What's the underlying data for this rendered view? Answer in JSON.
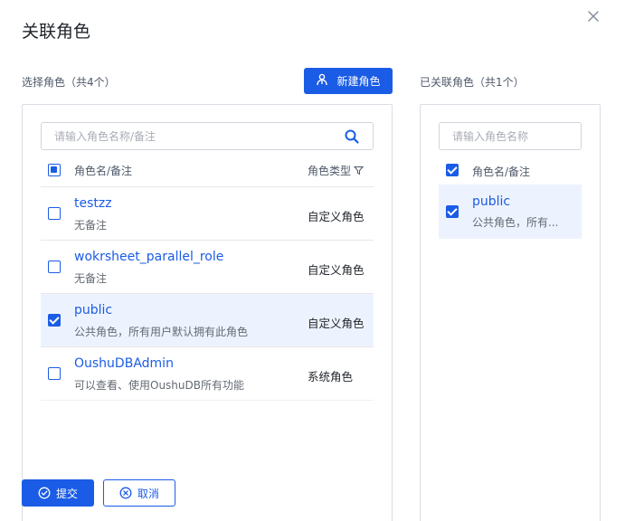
{
  "dialog": {
    "title": "关联角色",
    "close_icon": "close-icon"
  },
  "left": {
    "label": "选择角色（共4个）",
    "new_button_label": "新建角色",
    "new_button_icon": "new-role-icon",
    "search_placeholder": "请输入角色名称/备注",
    "search_value": "",
    "header_name": "角色名/备注",
    "header_type": "角色类型",
    "rows": [
      {
        "name": "testzz",
        "desc": "无备注",
        "type": "自定义角色",
        "checked": false
      },
      {
        "name": "wokrsheet_parallel_role",
        "desc": "无备注",
        "type": "自定义角色",
        "checked": false
      },
      {
        "name": "public",
        "desc": "公共角色，所有用户默认拥有此角色",
        "type": "自定义角色",
        "checked": true
      },
      {
        "name": "OushuDBAdmin",
        "desc": "可以查看、使用OushuDB所有功能",
        "type": "系统角色",
        "checked": false
      }
    ]
  },
  "right": {
    "label": "已关联角色（共1个）",
    "search_placeholder": "请输入角色名称",
    "search_value": "",
    "header_name": "角色名/备注",
    "rows": [
      {
        "name": "public",
        "desc": "公共角色，所有...",
        "checked": true
      }
    ]
  },
  "footer": {
    "submit_label": "提交",
    "cancel_label": "取消"
  },
  "colors": {
    "primary": "#1a5ce6",
    "selected_row": "#edf3fe",
    "border": "#d9dde3"
  }
}
